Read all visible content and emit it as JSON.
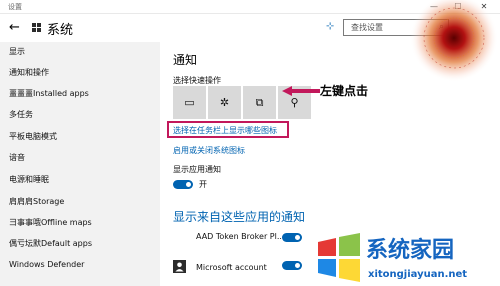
{
  "window": {
    "app_title": "设置",
    "minimize": "—",
    "maximize": "☐",
    "close": "✕"
  },
  "header": {
    "back_icon": "←",
    "title": "系统",
    "pin_icon": "⊹",
    "search_placeholder": "查找设置",
    "search_icon": "⌕"
  },
  "sidebar": {
    "items": [
      "显示",
      "通知和操作",
      "畺畺畺Installed apps",
      "多任务",
      "平板电脑模式",
      "谙音",
      "电源和睡眠",
      "肩肩肩Storage",
      "彐事事哦Offline maps",
      "偶亏坛默Default apps",
      "Windows Defender"
    ]
  },
  "main": {
    "heading": "通知",
    "quick_actions_label": "选择快速操作",
    "quick_actions": [
      "▭",
      "✲",
      "⧉",
      "⚲"
    ],
    "link_taskbar_icons": "选择在任务栏上显示哪些图标",
    "link_system_icons": "启用或关闭系统图标",
    "show_app_notifications_label": "显示应用通知",
    "toggle_state": "开",
    "apps_heading": "显示来自这些应用的通知",
    "apps": [
      {
        "name": "AAD Token Broker Pl...",
        "enabled": true
      },
      {
        "name": "Microsoft account",
        "enabled": true
      }
    ]
  },
  "annotation": {
    "text": "左键点击",
    "color": "#c2185b"
  },
  "watermark": {
    "brand": "系统家园",
    "url": "xitongjiayuan.net"
  },
  "colors": {
    "accent": "#0063b1",
    "sidebar_bg": "#f2f2f2",
    "tile_bg": "#d9d9d9",
    "highlight": "#c2185b"
  }
}
